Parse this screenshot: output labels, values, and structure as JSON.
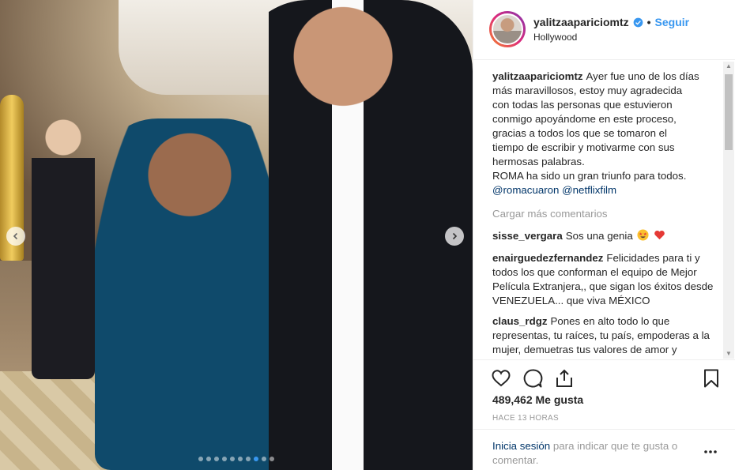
{
  "post": {
    "username": "yalitzaapariciomtz",
    "follow_label": "Seguir",
    "separator": "•",
    "location": "Hollywood",
    "verified": true
  },
  "media": {
    "slide_count": 10,
    "active_slide": 8
  },
  "caption": {
    "user": "yalitzaapariciomtz",
    "lines": [
      "Ayer fue uno de los días",
      "más maravillosos, estoy muy agradecida",
      "con todas las personas que estuvieron",
      "conmigo apoyándome en este proceso,",
      "gracias a todos los que se tomaron el",
      "tiempo de escribir y motivarme con sus",
      "hermosas palabras.",
      "ROMA ha sido un gran triunfo para todos."
    ],
    "mention1": "@romacuaron",
    "mention2": "@netflixfilm"
  },
  "load_more": "Cargar más comentarios",
  "comments": [
    {
      "user": "sisse_vergara",
      "text": "Sos una genia",
      "emojis": [
        "star-struck-emoji",
        "red-heart-emoji"
      ]
    },
    {
      "user": "enairguedezfernandez",
      "text": "Felicidades para ti y todos los que conforman el equipo de Mejor Película Extranjera,, que sigan los éxitos desde VENEZUELA... que viva MÉXICO"
    },
    {
      "user": "claus_rdgz",
      "text": "Pones en alto todo lo que representas, tu raíces, tu país, empoderas a la mujer, demuetras tus valores de amor y"
    }
  ],
  "likes": "489,462 Me gusta",
  "timestamp": "HACE 13 HORAS",
  "footer": {
    "login_link": "Inicia sesión",
    "login_rest": " para indicar que te gusta o comentar."
  },
  "colors": {
    "link_blue": "#3897f0",
    "mention_blue": "#003569",
    "muted": "#999999"
  }
}
